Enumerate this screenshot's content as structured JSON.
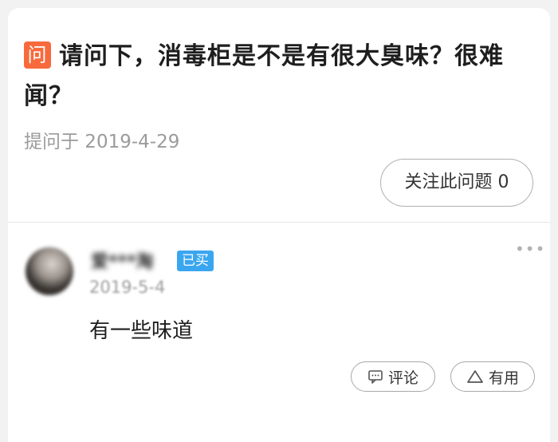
{
  "question": {
    "badge": "问",
    "title": "请问下，消毒柜是不是有很大臭味？很难闻？",
    "date": "提问于 2019-4-29",
    "follow_label": "关注此问题 0"
  },
  "answer": {
    "user_name": "爱***淘",
    "bought_badge": "已买",
    "date": "2019-5-4",
    "text": "有一些味道",
    "more_label": "•••",
    "comment_label": "评论",
    "useful_label": "有用"
  },
  "colors": {
    "question_badge": "#f86a3c",
    "bought_badge": "#3aa6f0",
    "page_bg": "#f2f2f2",
    "card_bg": "#ffffff"
  }
}
